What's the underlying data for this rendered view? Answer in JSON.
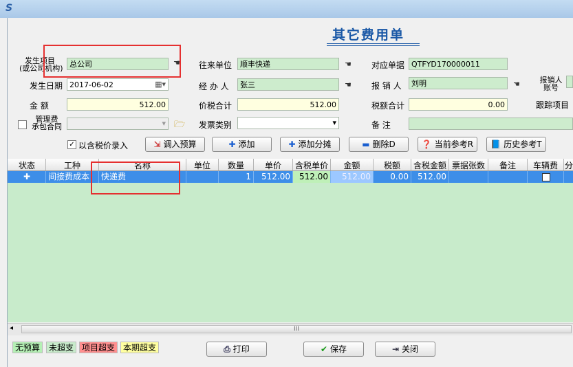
{
  "window": {
    "icon": "app-logo-icon"
  },
  "doc": {
    "title": "其它费用单"
  },
  "form": {
    "project_label_1": "发生项目",
    "project_label_2": "(或公司机构)",
    "project_value": "总公司",
    "partner_label": "往来单位",
    "partner_value": "顺丰快递",
    "ref_no_label": "对应单据",
    "ref_no_value": "QTFYD170000011",
    "date_label": "发生日期",
    "date_value": "2017-06-02",
    "handler_label": "经 办 人",
    "handler_value": "张三",
    "reimburser_label": "报 销 人",
    "reimburser_value": "刘明",
    "reimb_acct_label_1": "报销人",
    "reimb_acct_label_2": "账号",
    "amount_label": "金   额",
    "amount_value": "512.00",
    "price_tax_total_label": "价税合计",
    "price_tax_total_value": "512.00",
    "tax_total_label": "税额合计",
    "tax_total_value": "0.00",
    "track_item_label": "跟踪项目",
    "mgmt_fee_label_1": "管理费",
    "mgmt_fee_label_2": "承包合同",
    "invoice_type_label": "发票类别",
    "note_label": "备   注",
    "tax_included_label": "以含税价录入"
  },
  "buttons": {
    "import_budget": "调入预算",
    "add": "添加",
    "add_split": "添加分摊",
    "delete": "删除D",
    "current_ref": "当前参考R",
    "history_ref": "历史参考T",
    "print": "打印",
    "save": "保存",
    "close": "关闭"
  },
  "table": {
    "columns": [
      "状态",
      "工种",
      "名称",
      "单位",
      "数量",
      "单价",
      "含税单价",
      "金额",
      "税额",
      "含税金额",
      "票据张数",
      "备注",
      "车辆费",
      "分"
    ],
    "rows": [
      {
        "status_icon": "plus-icon",
        "type": "间接费成本",
        "name": "快递费",
        "unit": "",
        "qty": "1",
        "price": "512.00",
        "tax_price": "512.00",
        "amount": "512.00",
        "tax": "0.00",
        "tax_amount": "512.00",
        "receipts": "",
        "remark": "",
        "vehicle_fee": false
      }
    ]
  },
  "scrollbar": {
    "thumb_glyph": "III"
  },
  "legend": [
    {
      "label": "无预算",
      "color": "#b5f0b5"
    },
    {
      "label": "未超支",
      "color": "#c8ebcb"
    },
    {
      "label": "项目超支",
      "color": "#ff8f8f"
    },
    {
      "label": "本期超支",
      "color": "#ffffa0"
    }
  ]
}
